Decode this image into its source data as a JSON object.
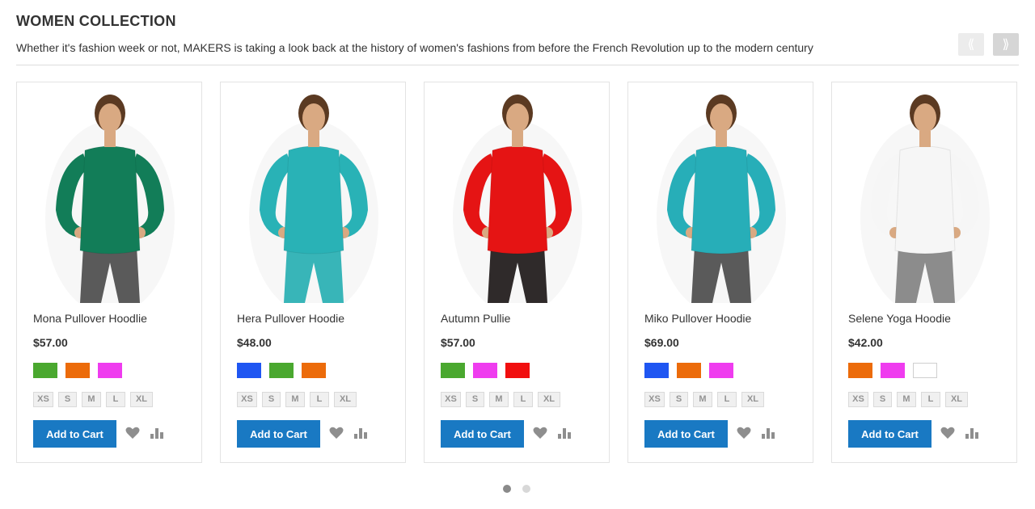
{
  "section": {
    "title": "WOMEN COLLECTION",
    "description": "Whether it's fashion week or not, MAKERS is taking a look back at the history of women's fashions from before the French Revolution up to the modern century",
    "prev_label": "⟪",
    "next_label": "⟫"
  },
  "products": [
    {
      "name": "Mona Pullover Hoodlie",
      "price": "$57.00",
      "swatches": [
        "#4aa82f",
        "#ec6b0a",
        "#ef3cef"
      ],
      "sizes": [
        "XS",
        "S",
        "M",
        "L",
        "XL"
      ],
      "add_label": "Add to Cart",
      "garment_color": "#127d58",
      "bottom_color": "#5a5a5a"
    },
    {
      "name": "Hera Pullover Hoodie",
      "price": "$48.00",
      "swatches": [
        "#1f56f2",
        "#4aa82f",
        "#ec6b0a"
      ],
      "sizes": [
        "XS",
        "S",
        "M",
        "L",
        "XL"
      ],
      "add_label": "Add to Cart",
      "garment_color": "#29b2b6",
      "bottom_color": "#38b5b8"
    },
    {
      "name": "Autumn Pullie",
      "price": "$57.00",
      "swatches": [
        "#4aa82f",
        "#ef3cef",
        "#f10f0f"
      ],
      "sizes": [
        "XS",
        "S",
        "M",
        "L",
        "XL"
      ],
      "add_label": "Add to Cart",
      "garment_color": "#e51414",
      "bottom_color": "#2f2a2a"
    },
    {
      "name": "Miko Pullover Hoodie",
      "price": "$69.00",
      "swatches": [
        "#1f56f2",
        "#ec6b0a",
        "#ef3cef"
      ],
      "sizes": [
        "XS",
        "S",
        "M",
        "L",
        "XL"
      ],
      "add_label": "Add to Cart",
      "garment_color": "#27aeb8",
      "bottom_color": "#5a5a5a"
    },
    {
      "name": "Selene Yoga Hoodie",
      "price": "$42.00",
      "swatches": [
        "#ec6b0a",
        "#ef3cef",
        "#ffffff"
      ],
      "sizes": [
        "XS",
        "S",
        "M",
        "L",
        "XL"
      ],
      "add_label": "Add to Cart",
      "garment_color": "#f6f6f6",
      "bottom_color": "#8c8c8c"
    }
  ],
  "icons": {
    "wishlist": "heart-icon",
    "compare": "compare-bars-icon"
  },
  "pagination": {
    "pages": 2,
    "active": 1
  },
  "colors": {
    "accent": "#1979c3",
    "dot_active": "#8a8a8a",
    "dot_inactive": "#d8d8d8"
  }
}
